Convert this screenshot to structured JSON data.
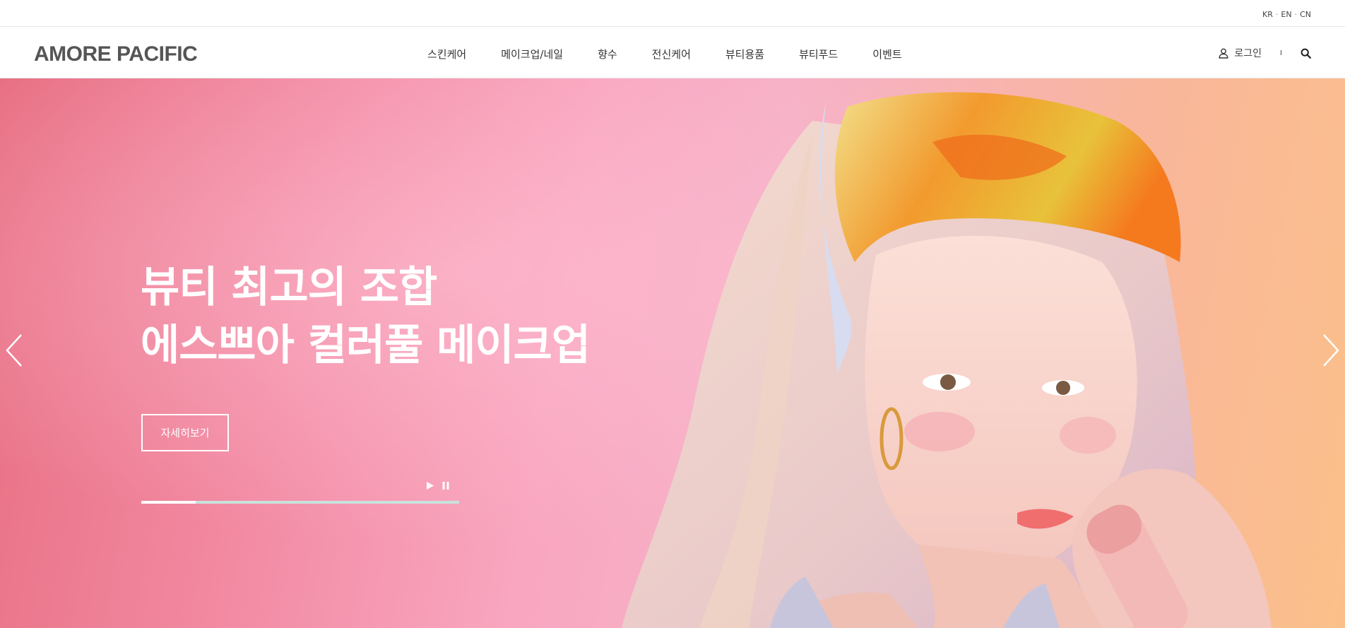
{
  "top_bar": {
    "languages": [
      "KR",
      "EN",
      "CN"
    ],
    "separator": "·"
  },
  "header": {
    "logo": "AMORE PACIFIC",
    "nav": [
      "스킨케어",
      "메이크업/네일",
      "향수",
      "전신케어",
      "뷰티용품",
      "뷰티푸드",
      "이벤트"
    ],
    "login_label": "로그인",
    "divider": "I",
    "icons": {
      "login": "user-icon",
      "search": "search-icon"
    }
  },
  "hero": {
    "title_line1": "뷰티 최고의 조합",
    "title_line2": "에스쁘아 컬러풀 메이크업",
    "button_label": "자세히보기",
    "progress": 0.17,
    "icons": {
      "prev": "chevron-left-icon",
      "next": "chevron-right-icon",
      "play": "play-icon",
      "pause": "pause-icon"
    },
    "colors": {
      "gradient_start": "#e86f83",
      "gradient_end": "#fbc08a",
      "progress_track": "#c9e2dc"
    }
  }
}
